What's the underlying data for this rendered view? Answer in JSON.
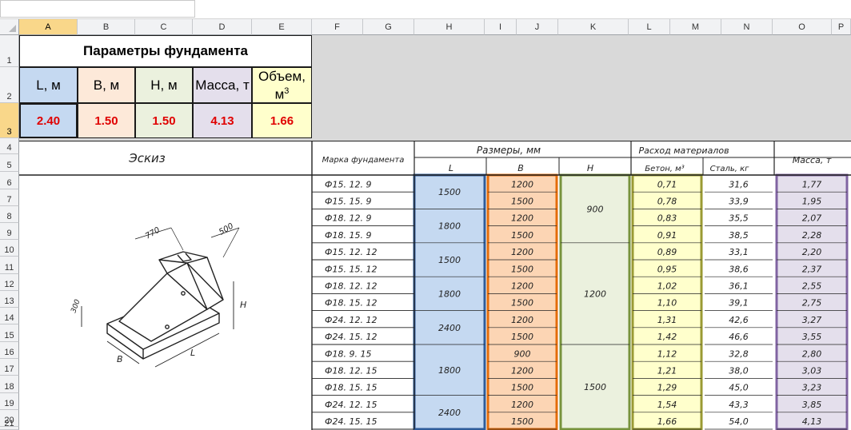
{
  "columns": [
    "A",
    "B",
    "C",
    "D",
    "E",
    "F",
    "G",
    "H",
    "I",
    "J",
    "K",
    "L",
    "M",
    "N",
    "O",
    "P"
  ],
  "selected_column": "A",
  "rows": [
    "1",
    "2",
    "3",
    "4",
    "5",
    "6",
    "7",
    "8",
    "9",
    "10",
    "11",
    "12",
    "13",
    "14",
    "15",
    "16",
    "17",
    "18",
    "19",
    "20",
    "21"
  ],
  "selected_row": "3",
  "params": {
    "title": "Параметры фундамента",
    "headers": {
      "L": "L, м",
      "B": "B, м",
      "H": "H, м",
      "mass": "Масса, т",
      "volume_line1": "Объем,",
      "volume_line2": "м",
      "volume_sup": "3"
    },
    "values": {
      "L": "2.40",
      "B": "1.50",
      "H": "1.50",
      "mass": "4.13",
      "volume": "1.66"
    },
    "colors": {
      "L": "#c5d9f1",
      "B": "#fde9d9",
      "H": "#ebf1de",
      "mass": "#e4dfec",
      "volume": "#ffffcc",
      "value_text": "#e00000"
    }
  },
  "table": {
    "sketch_label": "Эскиз",
    "mark_label": "Марка фундамента",
    "dims_label": "Размеры, мм",
    "dims_L": "L",
    "dims_B": "B",
    "dims_H": "H",
    "materials_label": "Расход материалов",
    "concrete_label": "Бетон, м³",
    "steel_label": "Сталь, кг",
    "mass_label": "Масса, т",
    "sketch_dims": {
      "d770": "770",
      "d500": "500",
      "d300": "300",
      "H": "H",
      "B": "B",
      "L": "L"
    },
    "rows": [
      {
        "mark": "Ф15. 12. 9",
        "B": "1200",
        "concrete": "0,71",
        "steel": "31,6",
        "mass": "1,77"
      },
      {
        "mark": "Ф15. 15. 9",
        "B": "1500",
        "concrete": "0,78",
        "steel": "33,9",
        "mass": "1,95"
      },
      {
        "mark": "Ф18. 12. 9",
        "B": "1200",
        "concrete": "0,83",
        "steel": "35,5",
        "mass": "2,07"
      },
      {
        "mark": "Ф18. 15. 9",
        "B": "1500",
        "concrete": "0,91",
        "steel": "38,5",
        "mass": "2,28"
      },
      {
        "mark": "Ф15. 12. 12",
        "B": "1200",
        "concrete": "0,89",
        "steel": "33,1",
        "mass": "2,20"
      },
      {
        "mark": "Ф15. 15. 12",
        "B": "1500",
        "concrete": "0,95",
        "steel": "38,6",
        "mass": "2,37"
      },
      {
        "mark": "Ф18. 12. 12",
        "B": "1200",
        "concrete": "1,02",
        "steel": "36,1",
        "mass": "2,55"
      },
      {
        "mark": "Ф18. 15. 12",
        "B": "1500",
        "concrete": "1,10",
        "steel": "39,1",
        "mass": "2,75"
      },
      {
        "mark": "Ф24. 12. 12",
        "B": "1200",
        "concrete": "1,31",
        "steel": "42,6",
        "mass": "3,27"
      },
      {
        "mark": "Ф24. 15. 12",
        "B": "1500",
        "concrete": "1,42",
        "steel": "46,6",
        "mass": "3,55"
      },
      {
        "mark": "Ф18. 9. 15",
        "B": "900",
        "concrete": "1,12",
        "steel": "32,8",
        "mass": "2,80"
      },
      {
        "mark": "Ф18. 12. 15",
        "B": "1200",
        "concrete": "1,21",
        "steel": "38,0",
        "mass": "3,03"
      },
      {
        "mark": "Ф18. 15. 15",
        "B": "1500",
        "concrete": "1,29",
        "steel": "45,0",
        "mass": "3,23"
      },
      {
        "mark": "Ф24. 12. 15",
        "B": "1200",
        "concrete": "1,54",
        "steel": "43,3",
        "mass": "3,85"
      },
      {
        "mark": "Ф24. 15. 15",
        "B": "1500",
        "concrete": "1,66",
        "steel": "54,0",
        "mass": "4,13"
      }
    ],
    "L_groups": [
      {
        "value": "1500",
        "rows": 2
      },
      {
        "value": "1800",
        "rows": 2
      },
      {
        "value": "1500",
        "rows": 2
      },
      {
        "value": "1800",
        "rows": 2
      },
      {
        "value": "2400",
        "rows": 2
      },
      {
        "value": "1800",
        "rows": 3
      },
      {
        "value": "2400",
        "rows": 2
      }
    ],
    "H_groups": [
      {
        "value": "900",
        "rows": 4
      },
      {
        "value": "1200",
        "rows": 6
      },
      {
        "value": "1500",
        "rows": 5
      }
    ],
    "colors": {
      "L": "#c5d9f1",
      "L_border": "#2e5c9a",
      "B": "#fcd5b4",
      "B_border": "#e46c0a",
      "H": "#ebf1de",
      "H_border": "#77933c",
      "concrete": "#ffffcc",
      "concrete_border": "#9a9a34",
      "mass": "#e4dfec",
      "mass_border": "#8064a2"
    }
  }
}
